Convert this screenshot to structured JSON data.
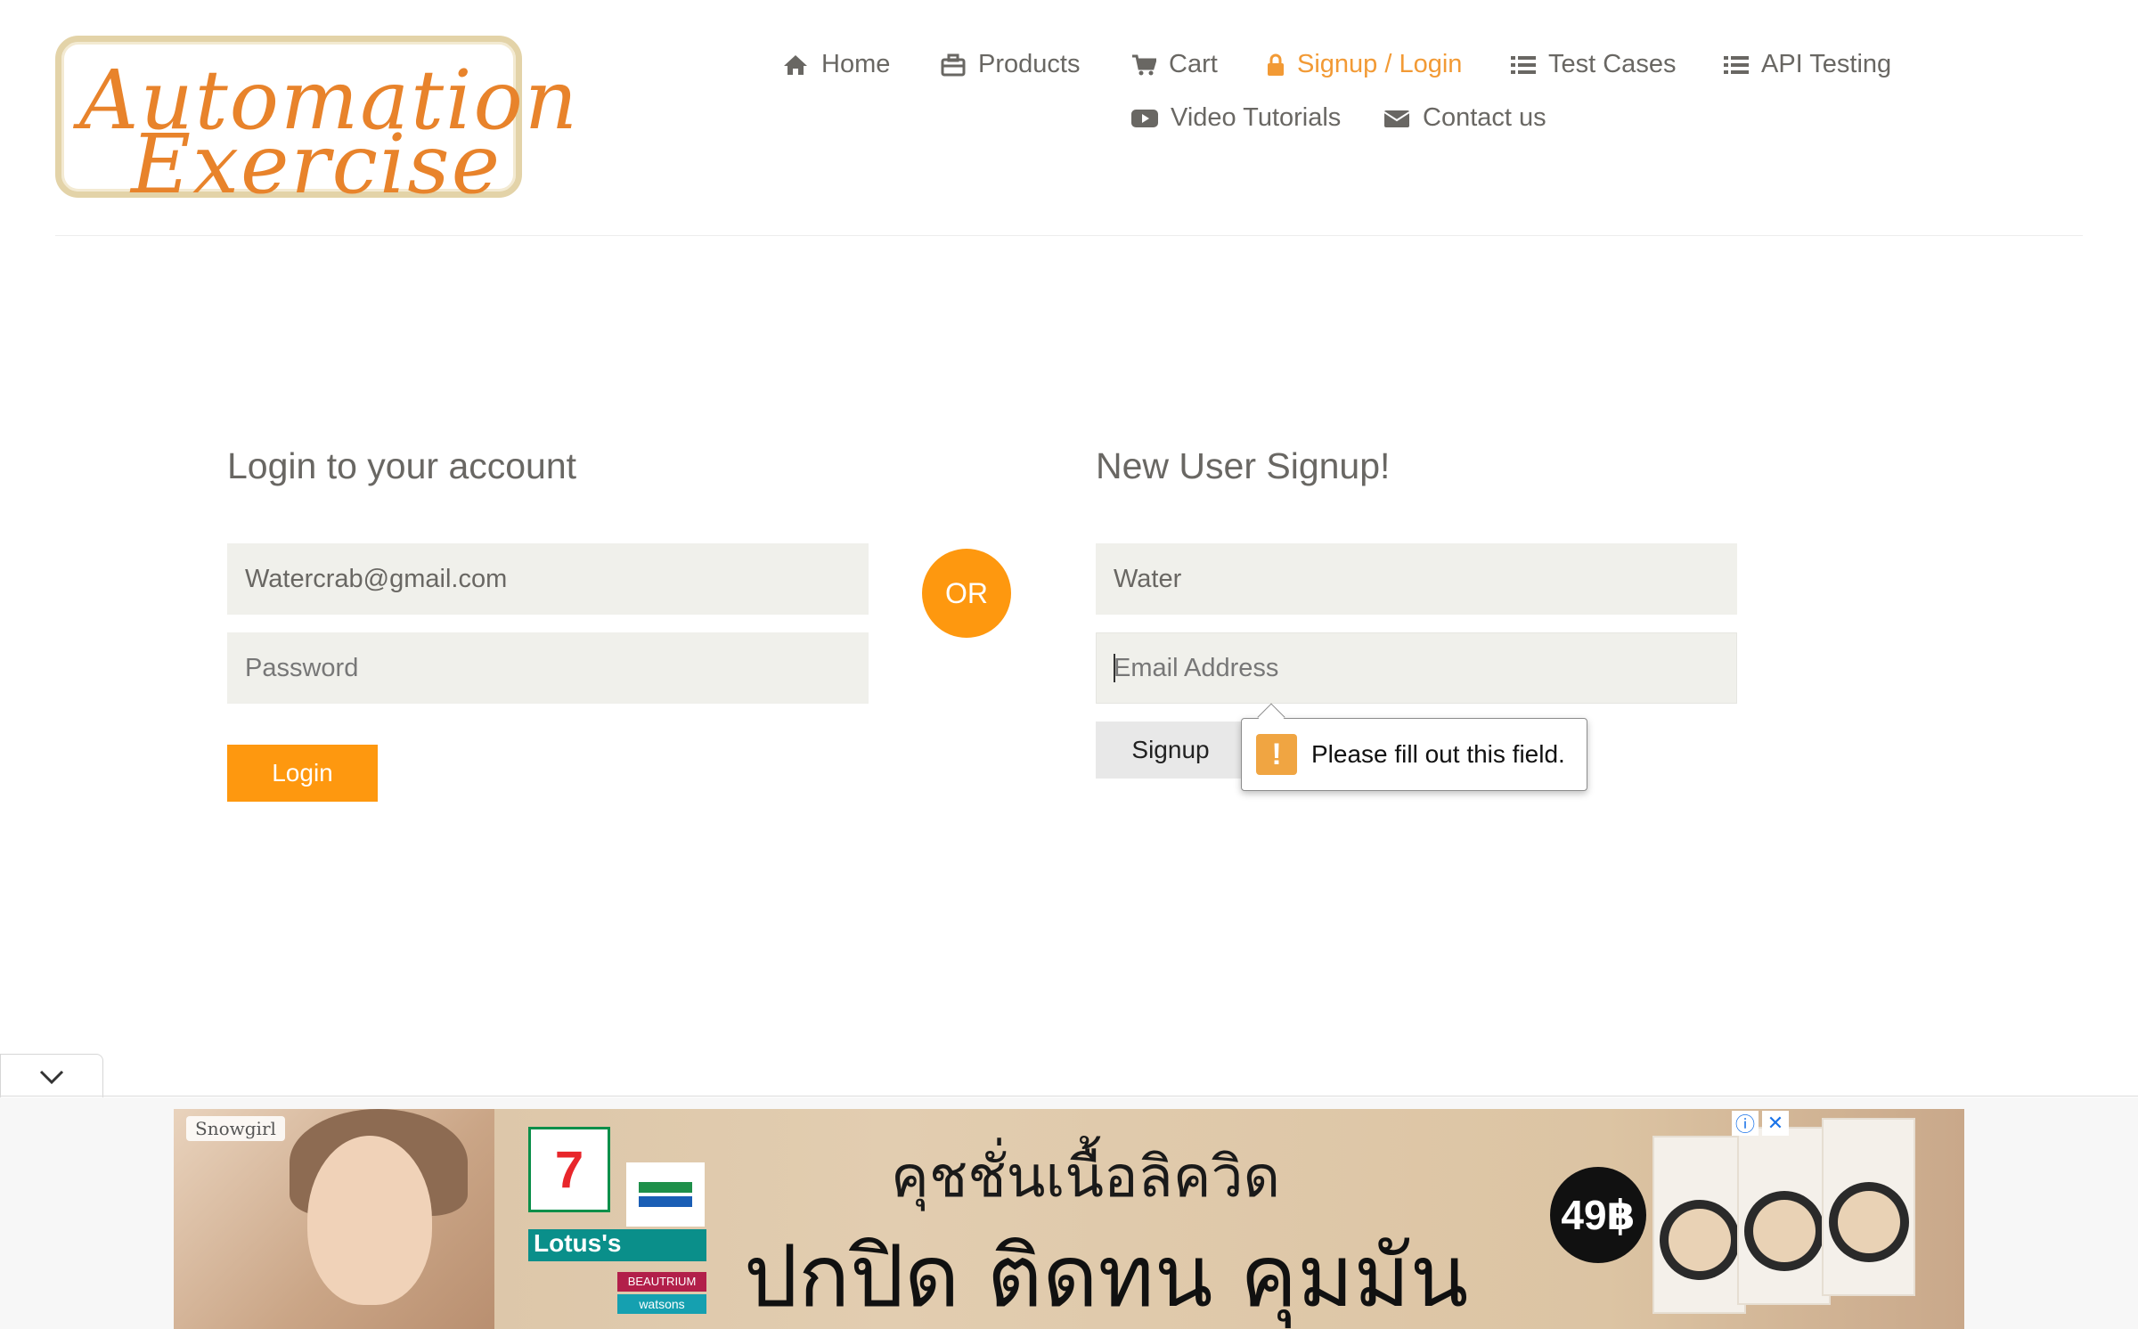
{
  "brand": {
    "line1": "Automation",
    "line2": "Exercise",
    "colors": {
      "accent": "#fe980f",
      "text": "#696763",
      "logo_border": "#e3d3a8"
    }
  },
  "nav": {
    "items": [
      {
        "label": "Home",
        "icon": "home-icon"
      },
      {
        "label": "Products",
        "icon": "products-icon"
      },
      {
        "label": "Cart",
        "icon": "cart-icon"
      },
      {
        "label": "Signup / Login",
        "icon": "lock-icon",
        "active": true
      },
      {
        "label": "Test Cases",
        "icon": "list-icon"
      },
      {
        "label": "API Testing",
        "icon": "list-icon"
      },
      {
        "label": "Video Tutorials",
        "icon": "youtube-icon"
      },
      {
        "label": "Contact us",
        "icon": "envelope-icon"
      }
    ]
  },
  "login": {
    "heading": "Login to your account",
    "email_value": "Watercrab@gmail.com",
    "password_placeholder": "Password",
    "button": "Login"
  },
  "divider": {
    "label": "OR"
  },
  "signup": {
    "heading": "New User Signup!",
    "name_value": "Water",
    "email_placeholder": "Email Address",
    "button": "Signup"
  },
  "validation": {
    "message": "Please fill out this field.",
    "icon": "warning-icon",
    "icon_glyph": "!"
  },
  "ad": {
    "brand_tag": "Snowgirl",
    "store_711": "7",
    "store_lotus": "Lotus's",
    "store_beautrium": "BEAUTRIUM",
    "store_watsons": "watsons",
    "line1": "คุชชั่นเนื้อลิควิด",
    "line2": "ปกปิด ติดทน คุมมัน",
    "price": "49฿",
    "info_glyph": "ⓘ",
    "close_glyph": "✕"
  }
}
